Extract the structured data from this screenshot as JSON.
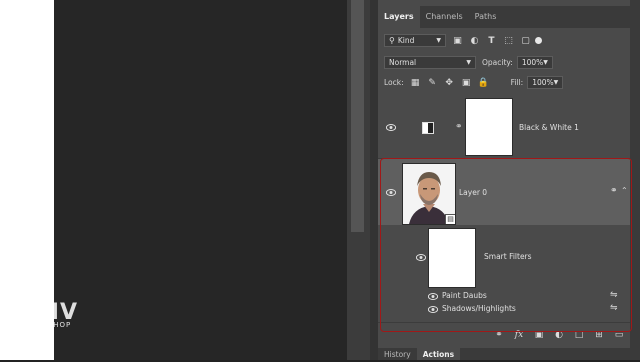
{
  "panel": {
    "tabs": [
      "Layers",
      "Channels",
      "Paths"
    ],
    "filter_kind": "Kind",
    "blend_mode": "Normal",
    "opacity_label": "Opacity:",
    "opacity_value": "100%",
    "lock_label": "Lock:",
    "fill_label": "Fill:",
    "fill_value": "100%"
  },
  "layers": [
    {
      "name": "Black & White 1",
      "type": "adjustment"
    },
    {
      "name": "Layer 0",
      "type": "smart-object",
      "selected": true
    },
    {
      "name": "Smart Filters",
      "type": "smart-filters"
    }
  ],
  "filters": [
    {
      "name": "Paint Daubs"
    },
    {
      "name": "Shadows/Highlights"
    }
  ],
  "bottom_tabs": [
    "History",
    "Actions"
  ],
  "watermark": {
    "main": "BLIV",
    "sub": "PHOTOSHOP"
  },
  "colors": {
    "highlight": "#a01818",
    "selected_row": "#5f5f5f"
  }
}
